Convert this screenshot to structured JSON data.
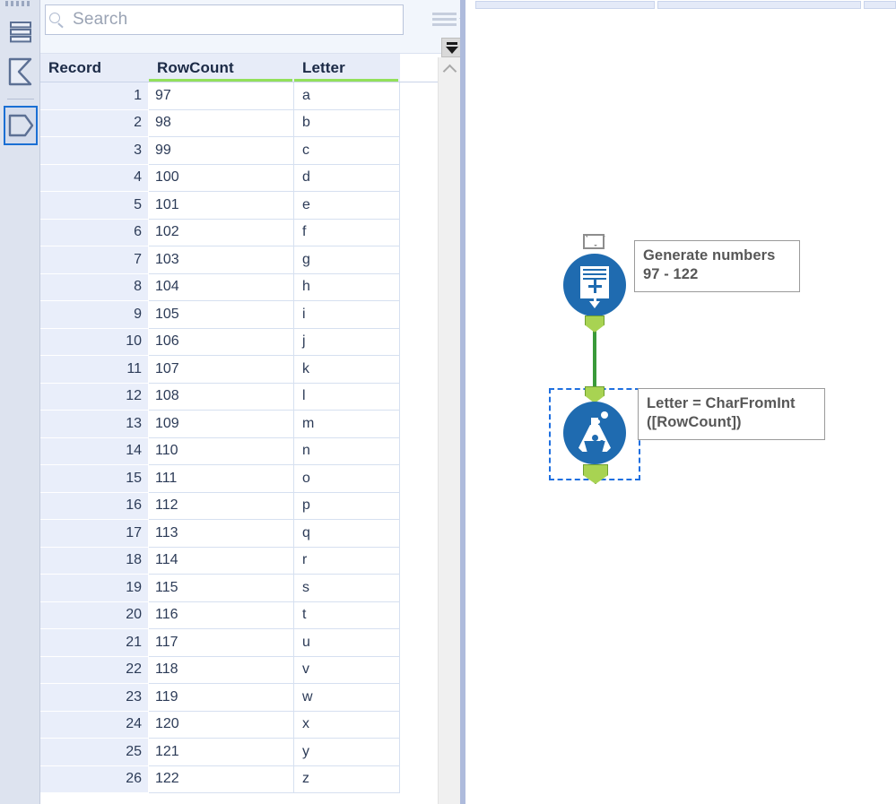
{
  "rail": {
    "items": [
      {
        "name": "data-grid-icon",
        "label": "Data",
        "selected": false
      },
      {
        "name": "summary-icon",
        "label": "Summary",
        "selected": false
      },
      {
        "name": "metadata-icon",
        "label": "Metadata",
        "selected": true
      }
    ]
  },
  "search": {
    "placeholder": "Search",
    "value": "",
    "icon": "search-icon",
    "menu_icon": "hamburger-menu-icon",
    "scroll_bottom_icon": "scroll-to-bottom-icon"
  },
  "grid": {
    "columns": [
      {
        "key": "record",
        "label": "Record",
        "underline": false,
        "align": "right"
      },
      {
        "key": "rowcount",
        "label": "RowCount",
        "underline": true,
        "align": "left"
      },
      {
        "key": "letter",
        "label": "Letter",
        "underline": true,
        "align": "left"
      }
    ],
    "rows": [
      {
        "record": "1",
        "rowcount": "97",
        "letter": "a"
      },
      {
        "record": "2",
        "rowcount": "98",
        "letter": "b"
      },
      {
        "record": "3",
        "rowcount": "99",
        "letter": "c"
      },
      {
        "record": "4",
        "rowcount": "100",
        "letter": "d"
      },
      {
        "record": "5",
        "rowcount": "101",
        "letter": "e"
      },
      {
        "record": "6",
        "rowcount": "102",
        "letter": "f"
      },
      {
        "record": "7",
        "rowcount": "103",
        "letter": "g"
      },
      {
        "record": "8",
        "rowcount": "104",
        "letter": "h"
      },
      {
        "record": "9",
        "rowcount": "105",
        "letter": "i"
      },
      {
        "record": "10",
        "rowcount": "106",
        "letter": "j"
      },
      {
        "record": "11",
        "rowcount": "107",
        "letter": "k"
      },
      {
        "record": "12",
        "rowcount": "108",
        "letter": "l"
      },
      {
        "record": "13",
        "rowcount": "109",
        "letter": "m"
      },
      {
        "record": "14",
        "rowcount": "110",
        "letter": "n"
      },
      {
        "record": "15",
        "rowcount": "111",
        "letter": "o"
      },
      {
        "record": "16",
        "rowcount": "112",
        "letter": "p"
      },
      {
        "record": "17",
        "rowcount": "113",
        "letter": "q"
      },
      {
        "record": "18",
        "rowcount": "114",
        "letter": "r"
      },
      {
        "record": "19",
        "rowcount": "115",
        "letter": "s"
      },
      {
        "record": "20",
        "rowcount": "116",
        "letter": "t"
      },
      {
        "record": "21",
        "rowcount": "117",
        "letter": "u"
      },
      {
        "record": "22",
        "rowcount": "118",
        "letter": "v"
      },
      {
        "record": "23",
        "rowcount": "119",
        "letter": "w"
      },
      {
        "record": "24",
        "rowcount": "120",
        "letter": "x"
      },
      {
        "record": "25",
        "rowcount": "121",
        "letter": "y"
      },
      {
        "record": "26",
        "rowcount": "122",
        "letter": "z"
      }
    ]
  },
  "scrollbar": {
    "up_icon": "chevron-up-icon"
  },
  "canvas": {
    "nodes": [
      {
        "name": "generate-rows-tool",
        "icon": "generate-rows-icon",
        "has_comment_flag": true,
        "selected": false,
        "comment": "Generate numbers\n97 - 122",
        "comment_line1": "Generate numbers",
        "comment_line2": "97 - 122"
      },
      {
        "name": "formula-tool",
        "icon": "flask-icon",
        "has_comment_flag": false,
        "selected": true,
        "comment": "Letter = CharFromInt ([RowCount])",
        "comment_line1": "Letter = CharFromInt",
        "comment_line2": "([RowCount])"
      }
    ],
    "connection": {
      "from": "generate-rows-tool",
      "to": "formula-tool",
      "color": "#3a9a3a"
    }
  },
  "colors": {
    "node_blue": "#1f6bb0",
    "anchor_green": "#a8d352",
    "header_underline": "#92e05a",
    "selection_blue": "#1e6fe0",
    "rail_bg": "#dde3ef"
  }
}
